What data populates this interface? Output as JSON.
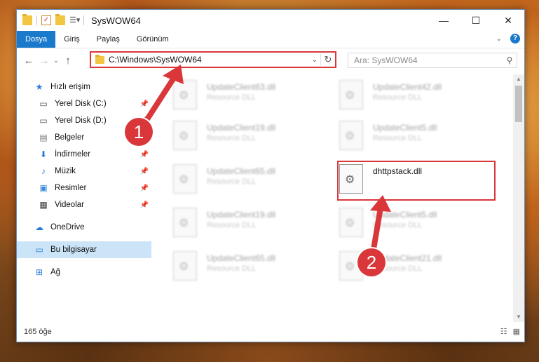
{
  "window": {
    "title": "SysWOW64",
    "controls": {
      "minimize": "—",
      "maximize": "☐",
      "close": "✕"
    }
  },
  "ribbon": {
    "tabs": [
      "Dosya",
      "Giriş",
      "Paylaş",
      "Görünüm"
    ],
    "active_tab": "Dosya",
    "help": "?"
  },
  "address_bar": {
    "path": "C:\\Windows\\SysWOW64",
    "search_placeholder": "Ara: SysWOW64"
  },
  "navigation": {
    "items": [
      {
        "label": "Hızlı erişim",
        "icon": "star-icon",
        "pinned": false
      },
      {
        "label": "Yerel Disk (C:)",
        "icon": "drive-icon",
        "pinned": true
      },
      {
        "label": "Yerel Disk (D:)",
        "icon": "drive-icon",
        "pinned": true
      },
      {
        "label": "Belgeler",
        "icon": "documents-icon",
        "pinned": true
      },
      {
        "label": "İndirmeler",
        "icon": "download-icon",
        "pinned": true
      },
      {
        "label": "Müzik",
        "icon": "music-icon",
        "pinned": true
      },
      {
        "label": "Resimler",
        "icon": "pictures-icon",
        "pinned": true
      },
      {
        "label": "Videolar",
        "icon": "videos-icon",
        "pinned": true
      },
      {
        "label": "OneDrive",
        "icon": "cloud-icon",
        "pinned": false
      },
      {
        "label": "Bu bilgisayar",
        "icon": "computer-icon",
        "pinned": false,
        "selected": true
      },
      {
        "label": "Ağ",
        "icon": "network-icon",
        "pinned": false
      }
    ]
  },
  "files": [
    {
      "name": "UpdateClient63.dll",
      "type": "Resource DLL"
    },
    {
      "name": "UpdateClient42.dll",
      "type": "Resource DLL"
    },
    {
      "name": "UpdateClient19.dll",
      "type": "Resource DLL"
    },
    {
      "name": "UpdateClient5.dll",
      "type": "Resource DLL"
    },
    {
      "name": "UpdateClient65.dll",
      "type": "Resource DLL"
    },
    {
      "name": "dhttpstack.dll",
      "type": "",
      "highlighted": true
    },
    {
      "name": "UpdateClient19.dll",
      "type": "Resource DLL"
    },
    {
      "name": "UpdateClient5.dll",
      "type": "Resource DLL"
    },
    {
      "name": "UpdateClient65.dll",
      "type": "Resource DLL"
    },
    {
      "name": "UpdateClient21.dll",
      "type": "Resource DLL"
    }
  ],
  "status": {
    "item_count": "165 öğe"
  },
  "annotations": {
    "step1": "1",
    "step2": "2",
    "color": "#d9373a"
  }
}
